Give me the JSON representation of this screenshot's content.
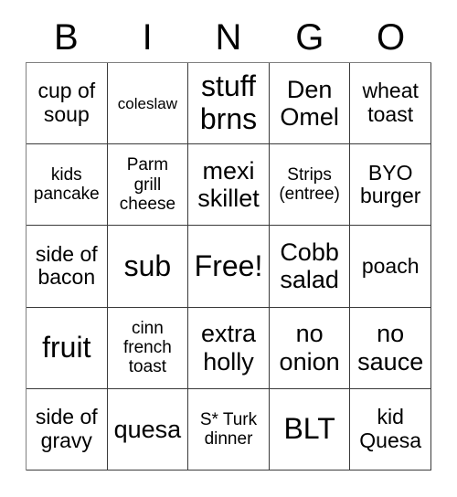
{
  "card": {
    "title": "BINGO",
    "header_letters": [
      "B",
      "I",
      "N",
      "G",
      "O"
    ],
    "free_space_label": "Free!",
    "colors": {
      "background": "#ffffff",
      "text": "#000000",
      "grid_line": "#3a3a3a"
    },
    "rows": [
      [
        {
          "text": "cup of\nsoup",
          "size": "sz-md"
        },
        {
          "text": "coleslaw",
          "size": "sz-xs"
        },
        {
          "text": "stuff\nbrns",
          "size": "sz-xl"
        },
        {
          "text": "Den\nOmel",
          "size": "sz-lg"
        },
        {
          "text": "wheat\ntoast",
          "size": "sz-md"
        }
      ],
      [
        {
          "text": "kids\npancake",
          "size": "sz-sm"
        },
        {
          "text": "Parm\ngrill\ncheese",
          "size": "sz-sm"
        },
        {
          "text": "mexi\nskillet",
          "size": "sz-lg"
        },
        {
          "text": "Strips\n(entree)",
          "size": "sz-sm"
        },
        {
          "text": "BYO\nburger",
          "size": "sz-md"
        }
      ],
      [
        {
          "text": "side of\nbacon",
          "size": "sz-md"
        },
        {
          "text": "sub",
          "size": "sz-xl"
        },
        {
          "text": "Free!",
          "size": "sz-xl"
        },
        {
          "text": "Cobb\nsalad",
          "size": "sz-lg"
        },
        {
          "text": "poach",
          "size": "sz-md"
        }
      ],
      [
        {
          "text": "fruit",
          "size": "sz-xl"
        },
        {
          "text": "cinn\nfrench\ntoast",
          "size": "sz-sm"
        },
        {
          "text": "extra\nholly",
          "size": "sz-lg"
        },
        {
          "text": "no\nonion",
          "size": "sz-lg"
        },
        {
          "text": "no\nsauce",
          "size": "sz-lg"
        }
      ],
      [
        {
          "text": "side of\ngravy",
          "size": "sz-md"
        },
        {
          "text": "quesa",
          "size": "sz-lg"
        },
        {
          "text": "S* Turk\ndinner",
          "size": "sz-sm"
        },
        {
          "text": "BLT",
          "size": "sz-xl"
        },
        {
          "text": "kid\nQuesa",
          "size": "sz-md"
        }
      ]
    ]
  }
}
